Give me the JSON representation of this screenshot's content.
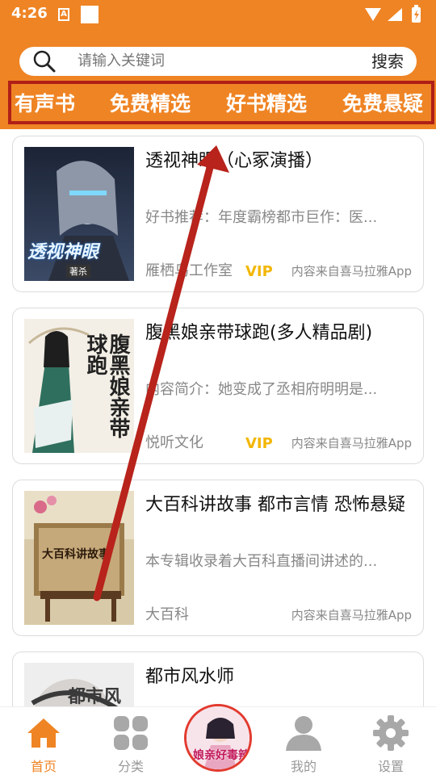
{
  "status_bar": {
    "time": "4:26",
    "notification_letter": "A"
  },
  "search": {
    "placeholder": "请输入关键词",
    "button_label": "搜索"
  },
  "category_tabs": [
    {
      "label": "有声书"
    },
    {
      "label": "免费精选"
    },
    {
      "label": "好书精选"
    },
    {
      "label": "免费悬疑"
    }
  ],
  "books": [
    {
      "title": "透视神眼（心冢演播）",
      "description": "好书推荐：年度霸榜都市巨作：医...",
      "author": "雁栖鸟工作室",
      "vip": "VIP",
      "source": "内容来自喜马拉雅App",
      "cover_text": "透视神眼",
      "cover_subtext": "著杀"
    },
    {
      "title": "腹黑娘亲带球跑(多人精品剧)",
      "description": "内容简介：她变成了丞相府明明是...",
      "author": "悦听文化",
      "vip": "VIP",
      "source": "内容来自喜马拉雅App",
      "cover_text": "腹黑娘亲带球跑"
    },
    {
      "title": "大百科讲故事 都市言情 恐怖悬疑",
      "description": "本专辑收录着大百科直播间讲述的...",
      "author": "大百科",
      "vip": "",
      "source": "内容来自喜马拉雅App",
      "cover_text": "大百科讲故事"
    },
    {
      "title": "都市风水师",
      "description": "",
      "author": "",
      "vip": "",
      "source": "",
      "cover_text": "都市风"
    }
  ],
  "bottom_nav": [
    {
      "label": "首页",
      "icon": "home-icon",
      "active": true
    },
    {
      "label": "分类",
      "icon": "category-grid-icon",
      "active": false
    },
    {
      "label": "",
      "icon": "featured-cover",
      "active": false,
      "cover_text": "娘亲好毒辣"
    },
    {
      "label": "我的",
      "icon": "user-icon",
      "active": false
    },
    {
      "label": "设置",
      "icon": "gear-icon",
      "active": false
    }
  ],
  "colors": {
    "brand_orange": "#ef8424",
    "active_nav": "#ef8424",
    "inactive_nav": "#999999",
    "vip_gold": "#f2b705",
    "tab_highlight_border": "#b01f17",
    "arrow": "#b8231b"
  }
}
